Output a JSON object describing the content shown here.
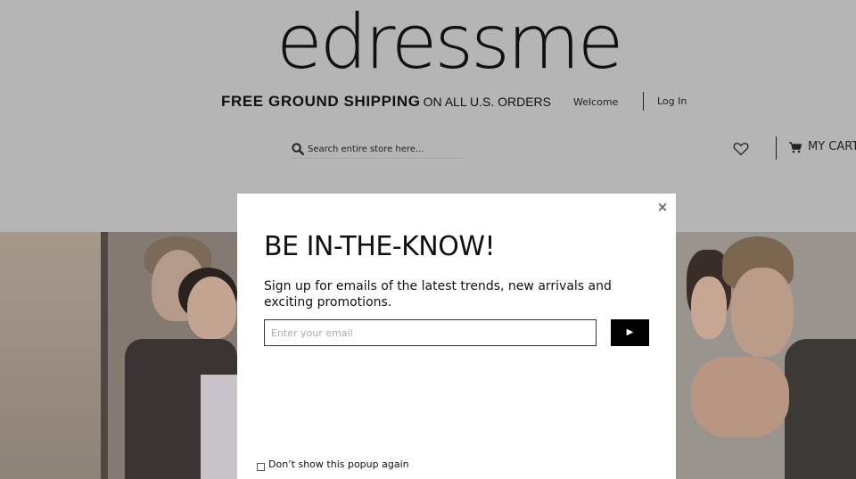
{
  "header": {
    "logo_text": "edressme",
    "shipping_bold": "FREE GROUND SHIPPING",
    "shipping_rest": "ON ALL U.S. ORDERS",
    "welcome": "Welcome",
    "login": "Log In",
    "search_placeholder": "Search entire store here...",
    "cart_label": "MY CART"
  },
  "icons": {
    "search": "search-icon",
    "wishlist": "heart-icon",
    "cart": "cart-icon",
    "close": "close-icon",
    "submit": "play-arrow-icon"
  },
  "modal": {
    "close_symbol": "×",
    "title": "BE IN-THE-KNOW!",
    "description": "Sign up for emails of the latest trends, new arrivals and exciting promotions.",
    "email_placeholder": "Enter your email",
    "submit_symbol": "▶",
    "dont_show_label": "Don’t show this popup again"
  },
  "colors": {
    "overlay_background": "#b5b5b5",
    "modal_background": "#ffffff",
    "submit_button": "#000000",
    "text": "#111111"
  }
}
